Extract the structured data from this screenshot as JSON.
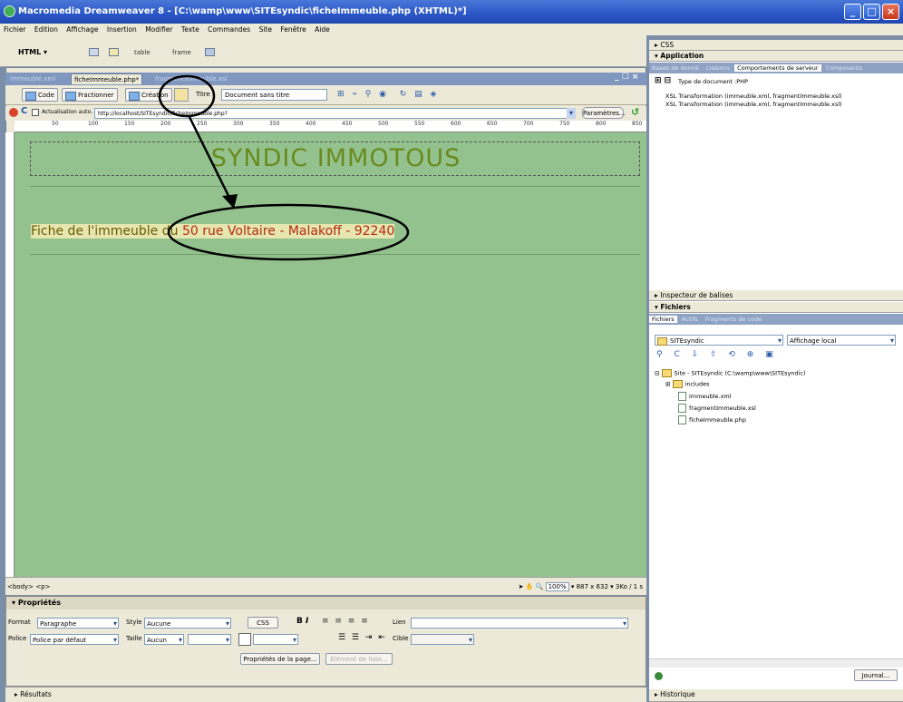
{
  "window": {
    "title": "Macromedia Dreamweaver 8 - [C:\\wamp\\www\\SITEsyndic\\ficheImmeuble.php (XHTML)*]"
  },
  "menu": [
    "Fichier",
    "Edition",
    "Affichage",
    "Insertion",
    "Modifier",
    "Texte",
    "Commandes",
    "Site",
    "Fenêtre",
    "Aide"
  ],
  "insertbar": {
    "category": "HTML",
    "table_label": "table",
    "frame_label": "frame"
  },
  "doc": {
    "tabs": [
      "immeuble.xml",
      "ficheImmeuble.php*",
      "fragmentImmeuble.xsl"
    ],
    "views": {
      "code": "Code",
      "split": "Fractionner",
      "design": "Création"
    },
    "title_label": "Titre :",
    "title_value": "Document sans titre",
    "auto_refresh_label": "Actualisation auto.",
    "address": "http://localhost/SITEsyndic/ficheImmeuble.php?",
    "params_button": "Paramètres...",
    "ruler_marks": [
      "50",
      "100",
      "150",
      "200",
      "250",
      "300",
      "350",
      "400",
      "450",
      "500",
      "550",
      "600",
      "650",
      "700",
      "750",
      "800",
      "850"
    ],
    "content": {
      "site_title": "SYNDIC IMMOTOUS",
      "fiche_label": "Fiche de l'immeuble du ",
      "fiche_value": "50 rue Voltaire - Malakoff - 92240"
    },
    "status": {
      "tags": "<body> <p>",
      "zoom": "100%",
      "size": "887 x 632",
      "weight": "3Ko / 1 s"
    }
  },
  "properties": {
    "title": "Propriétés",
    "format_label": "Format",
    "format_value": "Paragraphe",
    "style_label": "Style",
    "style_value": "Aucune",
    "css_button": "CSS",
    "link_label": "Lien",
    "font_label": "Police",
    "font_value": "Police par défaut",
    "size_label": "Taille",
    "size_value": "Aucun",
    "target_label": "Cible",
    "page_props_button": "Propriétés de la page...",
    "list_item_button": "Elément de liste..."
  },
  "results_label": "Résultats",
  "right_panel": {
    "css_label": "CSS",
    "application_label": "Application",
    "app_tabs": [
      "Bases de donné",
      "Liaisons",
      "Comportements de serveur",
      "Composants"
    ],
    "doc_type": "Type de document :PHP",
    "behaviors": [
      "XSL Transformation (immeuble.xml, fragmentImmeuble.xsl)",
      "XSL Transformation (immeuble.xml, fragmentImmeuble.xsl)"
    ],
    "tag_inspector_label": "Inspecteur de balises",
    "files_label": "Fichiers",
    "files_tabs": [
      "Fichiers",
      "Actifs",
      "Fragments de code"
    ],
    "site_select": "SITEsyndic",
    "view_select": "Affichage local",
    "tree": {
      "root": "Site - SITEsyndic (C:\\wamp\\www\\SITEsyndic)",
      "folder": "includes",
      "files": [
        "immeuble.xml",
        "fragmentImmeuble.xsl",
        "ficheImmeuble.php"
      ]
    },
    "journal_button": "Journal...",
    "history_label": "Historique"
  }
}
